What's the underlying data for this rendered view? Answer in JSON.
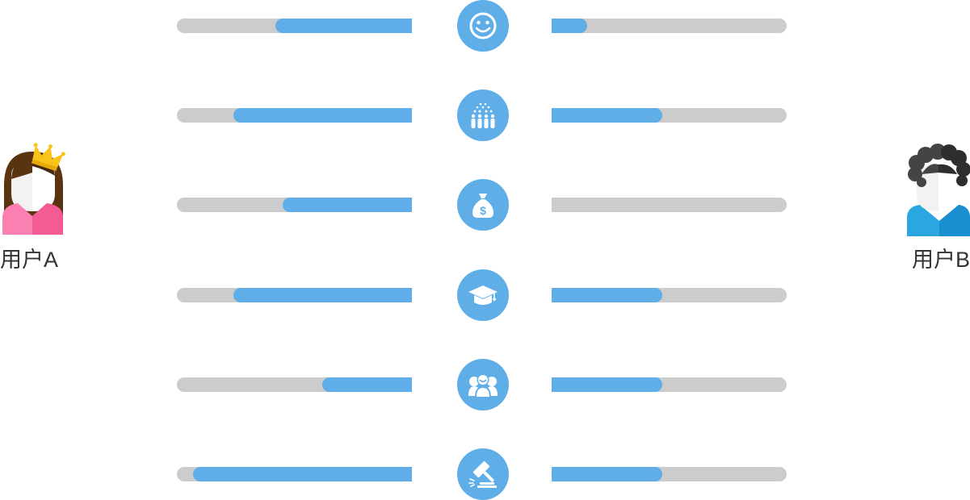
{
  "users": {
    "a": {
      "label": "用户A"
    },
    "b": {
      "label": "用户B"
    }
  },
  "colors": {
    "accent": "#5faee8",
    "track": "#cccccc",
    "text": "#333333"
  },
  "rows": [
    {
      "icon": "smiley-icon",
      "a_fraction": 0.58,
      "b_fraction": 0.15
    },
    {
      "icon": "audience-icon",
      "a_fraction": 0.76,
      "b_fraction": 0.47
    },
    {
      "icon": "money-bag-icon",
      "a_fraction": 0.55,
      "b_fraction": 0.0
    },
    {
      "icon": "graduation-cap-icon",
      "a_fraction": 0.76,
      "b_fraction": 0.47
    },
    {
      "icon": "group-icon",
      "a_fraction": 0.38,
      "b_fraction": 0.47
    },
    {
      "icon": "gavel-icon",
      "a_fraction": 0.93,
      "b_fraction": 0.47
    }
  ]
}
